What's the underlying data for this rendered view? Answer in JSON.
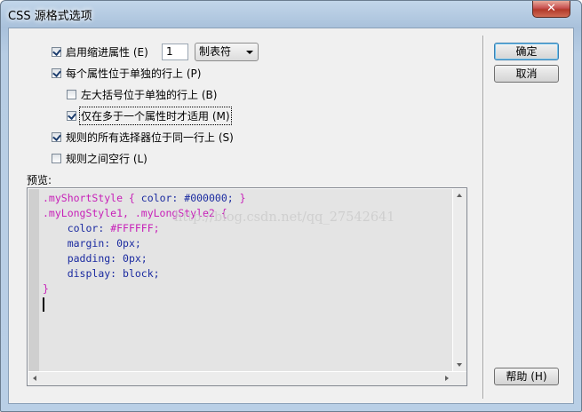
{
  "window": {
    "title": "CSS 源格式选项",
    "close_glyph": "✕"
  },
  "options": {
    "indent": {
      "label": "启用缩进属性 (E)",
      "checked": true,
      "spin_value": "1",
      "unit": "制表符"
    },
    "each_property": {
      "label": "每个属性位于单独的行上 (P)",
      "checked": true
    },
    "left_brace": {
      "label": "左大括号位于单独的行上 (B)",
      "checked": false
    },
    "only_if_more": {
      "label": "仅在多于一个属性时才适用 (M)",
      "checked": true
    },
    "selectors_same_line": {
      "label": "规则的所有选择器位于同一行上 (S)",
      "checked": true
    },
    "blank_line": {
      "label": "规则之间空行 (L)",
      "checked": false
    }
  },
  "buttons": {
    "ok": "确定",
    "cancel": "取消",
    "help": "帮助 (H)"
  },
  "preview": {
    "label": "预览:",
    "watermark": "http://blog.csdn.net/qq_27542641",
    "line1_selector": ".myShortStyle {",
    "line1_prop": "color:",
    "line1_value": "#000000;",
    "line1_close": "}",
    "line2_selector": ".myLongStyle1, .myLongStyle2 {",
    "line3_prop": "color:",
    "line3_value": "#FFFFFF;",
    "line4_prop": "margin:",
    "line4_value": "0px;",
    "line5_prop": "padding:",
    "line5_value": "0px;",
    "line6_prop": "display:",
    "line6_value": "block;",
    "line7_close": "}"
  },
  "colors": {
    "selector": "#c71fb8",
    "property": "#1a2aa0",
    "code_background": "#e4e4e4"
  },
  "icons": [
    "close-icon",
    "checkbox-checked-icon",
    "dropdown-arrow-icon",
    "scroll-arrow-icon"
  ]
}
